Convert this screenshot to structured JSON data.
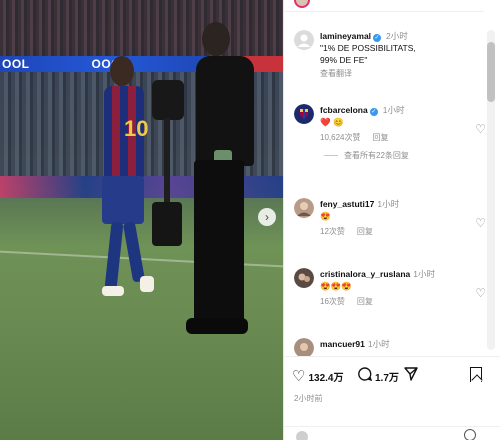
{
  "photo": {
    "ad_text": "OOL  ",
    "ad_text_2": "OOOL",
    "player_number": "10",
    "carousel_next_icon": "chevron-right-icon"
  },
  "comments": [
    {
      "user": "lamineyamal",
      "verified": true,
      "time": "2小时",
      "text": "\"1% DE POSSIBILITATS,\n99% DE FE\"",
      "translate": "查看翻译",
      "avatar": "default-avatar-icon"
    },
    {
      "user": "fcbarcelona",
      "verified": true,
      "time": "1小时",
      "text": "❤️ 😊",
      "likes": "10,624次赞",
      "reply": "回复",
      "view_replies": "查看所有22条回复",
      "avatar": "fcb-crest-icon"
    },
    {
      "user": "feny_astuti17",
      "verified": false,
      "time": "1小时",
      "text": "😍",
      "likes": "12次赞",
      "reply": "回复",
      "avatar": "user-photo-avatar"
    },
    {
      "user": "cristinalora_y_ruslana",
      "verified": false,
      "time": "1小时",
      "text": "😍😍😍",
      "likes": "16次赞",
      "reply": "回复",
      "avatar": "user-photo-avatar"
    },
    {
      "user": "mancuer91",
      "verified": false,
      "time": "1小时",
      "avatar": "user-photo-avatar"
    }
  ],
  "actions": {
    "like_icon": "heart-icon",
    "like_count": "132.4万",
    "comment_icon": "comment-icon",
    "comment_count": "1.7万",
    "share_icon": "send-icon",
    "save_icon": "bookmark-icon",
    "post_time": "2小时前"
  },
  "colors": {
    "verified": "#3897f0",
    "muted_text": "#8e8e8e",
    "story_ring": "#e1306c"
  }
}
